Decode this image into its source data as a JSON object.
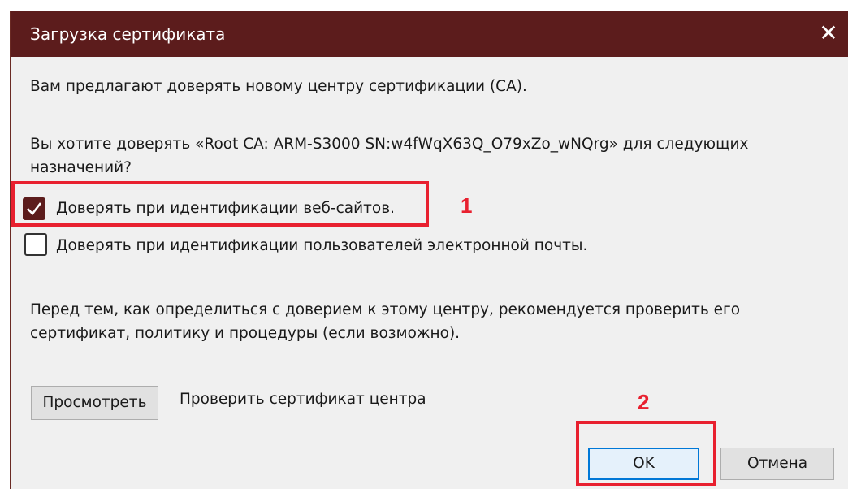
{
  "window": {
    "title": "Загрузка сертификата",
    "close_symbol": "✕"
  },
  "content": {
    "intro": "Вам предлагают доверять новому центру сертификации (CA).",
    "question_line1": "Вы хотите доверять «Root CA: ARM-S3000 SN:w4fWqX63Q_O79xZo_wNQrg» для следующих",
    "question_line2": "назначений?",
    "trust_websites_label": "Доверять при идентификации веб-сайтов.",
    "trust_websites_checked": true,
    "trust_email_label": "Доверять при идентификации пользователей электронной почты.",
    "trust_email_checked": false,
    "advice_line1": "Перед тем, как определиться с доверием к этому центру, рекомендуется проверить его",
    "advice_line2": "сертификат, политику и процедуры (если возможно).",
    "view_button_label": "Просмотреть",
    "view_description": "Проверить сертификат центра"
  },
  "footer": {
    "ok_label": "OK",
    "cancel_label": "Отмена"
  },
  "annotations": {
    "marker1": "1",
    "marker2": "2",
    "highlight_color": "#e8202f"
  },
  "colors": {
    "titlebar": "#5c1c1c",
    "dialog_bg": "#f0f0f0",
    "default_button_border": "#0078d7"
  }
}
